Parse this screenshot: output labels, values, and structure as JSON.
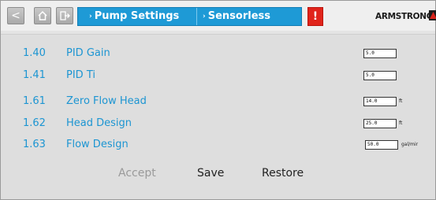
{
  "nav": {
    "back_glyph": "<",
    "home_icon": "home-icon",
    "exit_icon": "exit-icon"
  },
  "breadcrumb": {
    "items": [
      "Pump Settings",
      "Sensorless"
    ]
  },
  "alert": {
    "label": "!"
  },
  "brand": {
    "name": "ARMSTRONG"
  },
  "colors": {
    "accent": "#1e9ad6",
    "param_text": "#1c95d2",
    "alert": "#e0241b"
  },
  "params": [
    {
      "id": "1.40",
      "label": "PID Gain",
      "value": "5.0",
      "unit": ""
    },
    {
      "id": "1.41",
      "label": "PID Ti",
      "value": "5.0",
      "unit": ""
    },
    {
      "id": "1.61",
      "label": "Zero Flow Head",
      "value": "14.0",
      "unit": "ft"
    },
    {
      "id": "1.62",
      "label": "Head Design",
      "value": "25.0",
      "unit": "ft"
    },
    {
      "id": "1.63",
      "label": "Flow Design",
      "value": "50.0",
      "unit": "gal/mir"
    }
  ],
  "actions": {
    "accept": "Accept",
    "save": "Save",
    "restore": "Restore"
  }
}
